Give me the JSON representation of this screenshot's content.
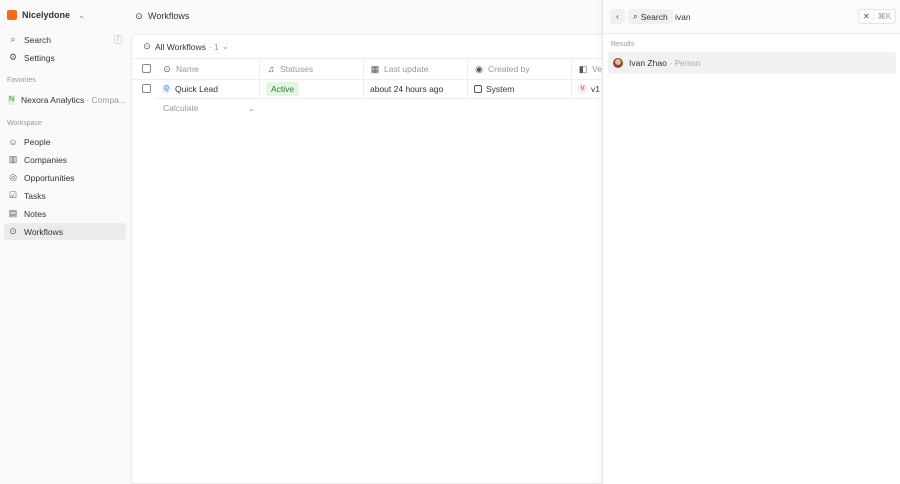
{
  "workspace": {
    "name": "Nicelydone"
  },
  "sidebar": {
    "search": "Search",
    "search_shortcut": "/",
    "settings": "Settings",
    "favorites_label": "Favorites",
    "favorite": {
      "badge": "N",
      "name": "Nexora Analytics",
      "suffix": "· Compa..."
    },
    "workspace_label": "Workspace",
    "items": [
      {
        "label": "People"
      },
      {
        "label": "Companies"
      },
      {
        "label": "Opportunities"
      },
      {
        "label": "Tasks"
      },
      {
        "label": "Notes"
      },
      {
        "label": "Workflows"
      }
    ]
  },
  "header": {
    "title": "Workflows"
  },
  "view": {
    "name": "All Workflows",
    "count": "· 1"
  },
  "table": {
    "columns": [
      "Name",
      "Statuses",
      "Last update",
      "Created by",
      "Ver"
    ],
    "rows": [
      {
        "name": "Quick Lead",
        "status": "Active",
        "last_update": "about 24 hours ago",
        "created_by": "System",
        "version": "v1",
        "version_badge": "V"
      }
    ],
    "calculate": "Calculate"
  },
  "search_panel": {
    "button": "Search",
    "query": "ivan",
    "shortcut": "⌘K",
    "results_label": "Results",
    "results": [
      {
        "name": "Ivan Zhao",
        "type": "· Person"
      }
    ]
  },
  "colors": {
    "accent": "#f97316",
    "active_bg": "#e6f6e6",
    "active_fg": "#2e7d32"
  }
}
